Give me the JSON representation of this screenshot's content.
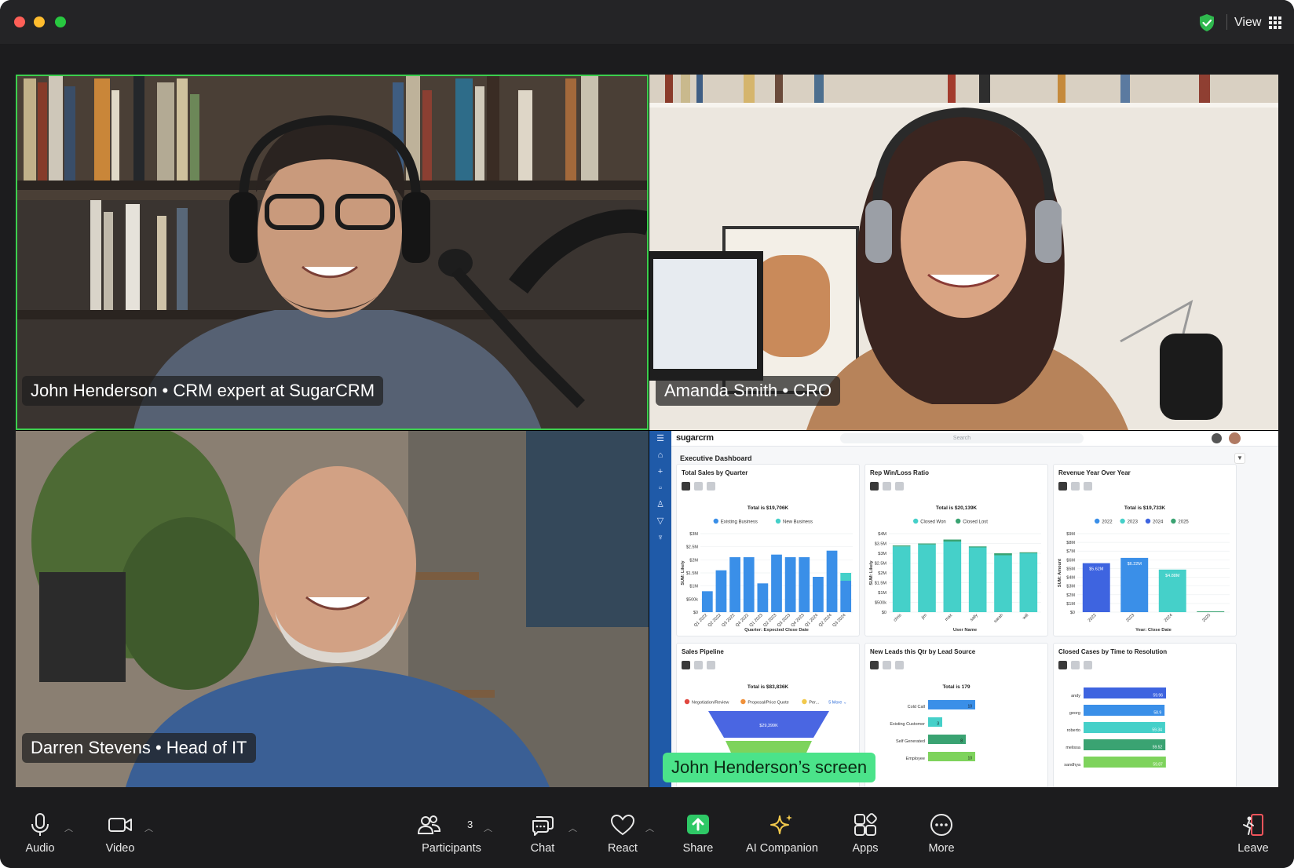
{
  "window": {
    "view_label": "View"
  },
  "participants": [
    {
      "name_label": "John Henderson • CRM expert at SugarCRM"
    },
    {
      "name_label": "Amanda Smith • CRO"
    },
    {
      "name_label": "Darren Stevens • Head of IT"
    }
  ],
  "share": {
    "label": "John Henderson’s screen",
    "app": {
      "logo": "sugarcrm",
      "search_placeholder": "Search",
      "dashboard_title": "Executive Dashboard",
      "dashlets": [
        {
          "title": "Total Sales by Quarter",
          "total": "Total is $19,706K"
        },
        {
          "title": "Rep Win/Loss Ratio",
          "total": "Total is $20,139K"
        },
        {
          "title": "Revenue Year Over Year",
          "total": "Total is $19,733K"
        },
        {
          "title": "Sales Pipeline",
          "total": "Total is $83,836K"
        },
        {
          "title": "New Leads this Qtr by Lead Source",
          "total": "Total is 179"
        },
        {
          "title": "Closed Cases by Time to Resolution",
          "total": ""
        }
      ]
    }
  },
  "chart_data": [
    {
      "type": "bar",
      "title": "Total Sales by Quarter",
      "xlabel": "Quarter: Expected Close Date",
      "ylabel": "SUM: Likely",
      "legend": [
        "Existing Business",
        "New Business"
      ],
      "categories": [
        "Q1 2022",
        "Q2 2022",
        "Q3 2022",
        "Q4 2022",
        "Q1 2023",
        "Q2 2023",
        "Q3 2023",
        "Q4 2023",
        "Q1 2024",
        "Q2 2024",
        "Q3 2024"
      ],
      "y_ticks": [
        "$0",
        "$500k",
        "$1M",
        "$1.5M",
        "$2M",
        "$2.5M",
        "$3M"
      ],
      "series": [
        {
          "name": "Existing Business",
          "values": [
            0.8,
            1.6,
            2.1,
            2.1,
            1.1,
            2.2,
            2.1,
            2.1,
            1.35,
            2.35,
            1.2
          ]
        },
        {
          "name": "New Business",
          "values": [
            0,
            0,
            0,
            0,
            0,
            0,
            0,
            0,
            0,
            0,
            0.3
          ]
        }
      ],
      "ylim": [
        0,
        3
      ]
    },
    {
      "type": "bar",
      "title": "Rep Win/Loss Ratio",
      "xlabel": "User Name",
      "ylabel": "SUM: Likely",
      "legend": [
        "Closed Won",
        "Closed Lost"
      ],
      "categories": [
        "chris",
        "jim",
        "max",
        "sally",
        "sarah",
        "will"
      ],
      "y_ticks": [
        "$0",
        "$500k",
        "$1M",
        "$1.5M",
        "$2M",
        "$2.5M",
        "$3M",
        "$3.5M",
        "$4M"
      ],
      "series": [
        {
          "name": "Closed Won",
          "values": [
            3.35,
            3.45,
            3.6,
            3.3,
            2.9,
            3.0
          ]
        },
        {
          "name": "Closed Lost",
          "values": [
            0.05,
            0.05,
            0.1,
            0.05,
            0.1,
            0.05
          ]
        }
      ],
      "ylim": [
        0,
        4
      ]
    },
    {
      "type": "bar",
      "title": "Revenue Year Over Year",
      "xlabel": "Year: Close Date",
      "ylabel": "SUM: Amount",
      "legend": [
        "2022",
        "2023",
        "2024",
        "2025"
      ],
      "categories": [
        "2022",
        "2023",
        "2024",
        "2025"
      ],
      "y_ticks": [
        "$0",
        "$1M",
        "$2M",
        "$3M",
        "$4M",
        "$5M",
        "$6M",
        "$7M",
        "$8M",
        "$9M"
      ],
      "values": [
        5.62,
        6.22,
        4.88,
        0
      ],
      "data_labels": [
        "$5.62M",
        "$6.22M",
        "$4.88M",
        ""
      ],
      "ylim": [
        0,
        9
      ]
    },
    {
      "type": "bar",
      "title": "New Leads this Qtr by Lead Source",
      "categories": [
        "Cold Call",
        "Existing Customer",
        "Self Generated",
        "Employee"
      ],
      "values": [
        10,
        3,
        8,
        10
      ],
      "data_labels": [
        "10",
        "3",
        "8",
        "10"
      ]
    },
    {
      "type": "bar",
      "title": "Closed Cases by Time to Resolution",
      "categories": [
        "andy",
        "georg",
        "roberto",
        "melissa",
        "sandhya"
      ],
      "data_labels": [
        "59.96",
        "58.9",
        "59.34",
        "59.52",
        "59.87"
      ],
      "values": [
        59.96,
        58.9,
        59.34,
        59.52,
        59.87
      ]
    },
    {
      "type": "bar",
      "title": "Sales Pipeline",
      "legend": [
        "Negotiation/Review",
        "Proposal/Price Quote",
        "Per...",
        "5 More"
      ],
      "data_labels": [
        "$29,399K"
      ]
    }
  ],
  "controls": {
    "audio": "Audio",
    "video": "Video",
    "participants": "Participants",
    "participants_count": "3",
    "chat": "Chat",
    "react": "React",
    "share": "Share",
    "ai_companion": "AI Companion",
    "apps": "Apps",
    "more": "More",
    "leave": "Leave"
  },
  "colors": {
    "active_speaker": "#3ccf4e",
    "share_label_bg": "#4be38a",
    "share_icon": "#2ec866",
    "ai_icon": "#f2c94c",
    "leave_icon": "#f2545b"
  }
}
